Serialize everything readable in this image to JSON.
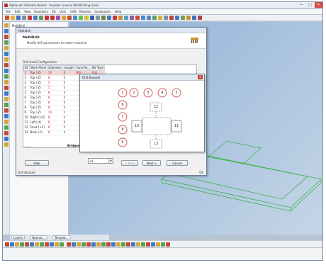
{
  "window": {
    "title": "Alphacam Ultimate Router - Reseller License MultiDrilling (Geo)",
    "min": "—",
    "max": "□",
    "close": "✕"
  },
  "menu": [
    "File",
    "Edit",
    "View",
    "Geometry",
    "3D",
    "Utils",
    "CAD",
    "Machine",
    "Constraints",
    "Help"
  ],
  "left_panel": {
    "title": "MultiDrill"
  },
  "panel_tabs": [
    "Layers",
    "Operati...",
    "Templat..."
  ],
  "multidrill": {
    "window_title": "Multidrill",
    "heading": "MultiDrill",
    "subheading": "Modify drill parameters to match machine.",
    "group_label": "Drill Head Configuration",
    "columns": [
      "ID",
      "Work Plane",
      "Diameter",
      "Length",
      "Cone Ro...",
      "Bit Type"
    ],
    "rows": [
      [
        "1",
        "Top (-Z)",
        "10",
        "0",
        "180",
        "Flat"
      ],
      [
        "2",
        "Top (-Z)",
        "8",
        "0",
        "",
        ""
      ],
      [
        "3",
        "Top (-Z)",
        "5",
        "0",
        "",
        ""
      ],
      [
        "4",
        "Top (-Z)",
        "5",
        "0",
        "",
        ""
      ],
      [
        "5",
        "Top (-Z)",
        "8",
        "0",
        "",
        ""
      ],
      [
        "6",
        "Top (-Z)",
        "8",
        "0",
        "",
        ""
      ],
      [
        "7",
        "Top (-Z)",
        "8",
        "0",
        "",
        ""
      ],
      [
        "8",
        "Top (-Z)",
        "8",
        "0",
        "",
        ""
      ],
      [
        "9",
        "Top (-Z)",
        "10",
        "0",
        "",
        ""
      ],
      [
        "10",
        "Right (+X)",
        "8",
        "0",
        "",
        ""
      ],
      [
        "11",
        "Left (-X)",
        "8",
        "0",
        "",
        ""
      ],
      [
        "12",
        "Front (+Y)",
        "8",
        "0",
        "",
        ""
      ],
      [
        "13",
        "Back (-Y)",
        "8",
        "0",
        "",
        ""
      ]
    ],
    "bridges_label": "Bridges",
    "help": "Help",
    "next": "Next >",
    "cancel": "Cancel",
    "back": "< Back",
    "combo_value": "ok",
    "status_left": "Drill Bousaki",
    "status_right": "OK"
  },
  "drill_dialog": {
    "title": "Drill Bousaki",
    "close": "✕",
    "top_heads": [
      "1",
      "2",
      "3",
      "4",
      "5"
    ],
    "left_heads": [
      "6",
      "7",
      "8",
      "9"
    ],
    "labels": {
      "back": "12",
      "left": "10",
      "right": "11",
      "front": "13"
    }
  },
  "colors": {
    "accent_red": "#c21f1f",
    "window_border": "#6f7f92",
    "canvas_blue": "#9bb8d9",
    "wire_green": "#3bb34a"
  }
}
